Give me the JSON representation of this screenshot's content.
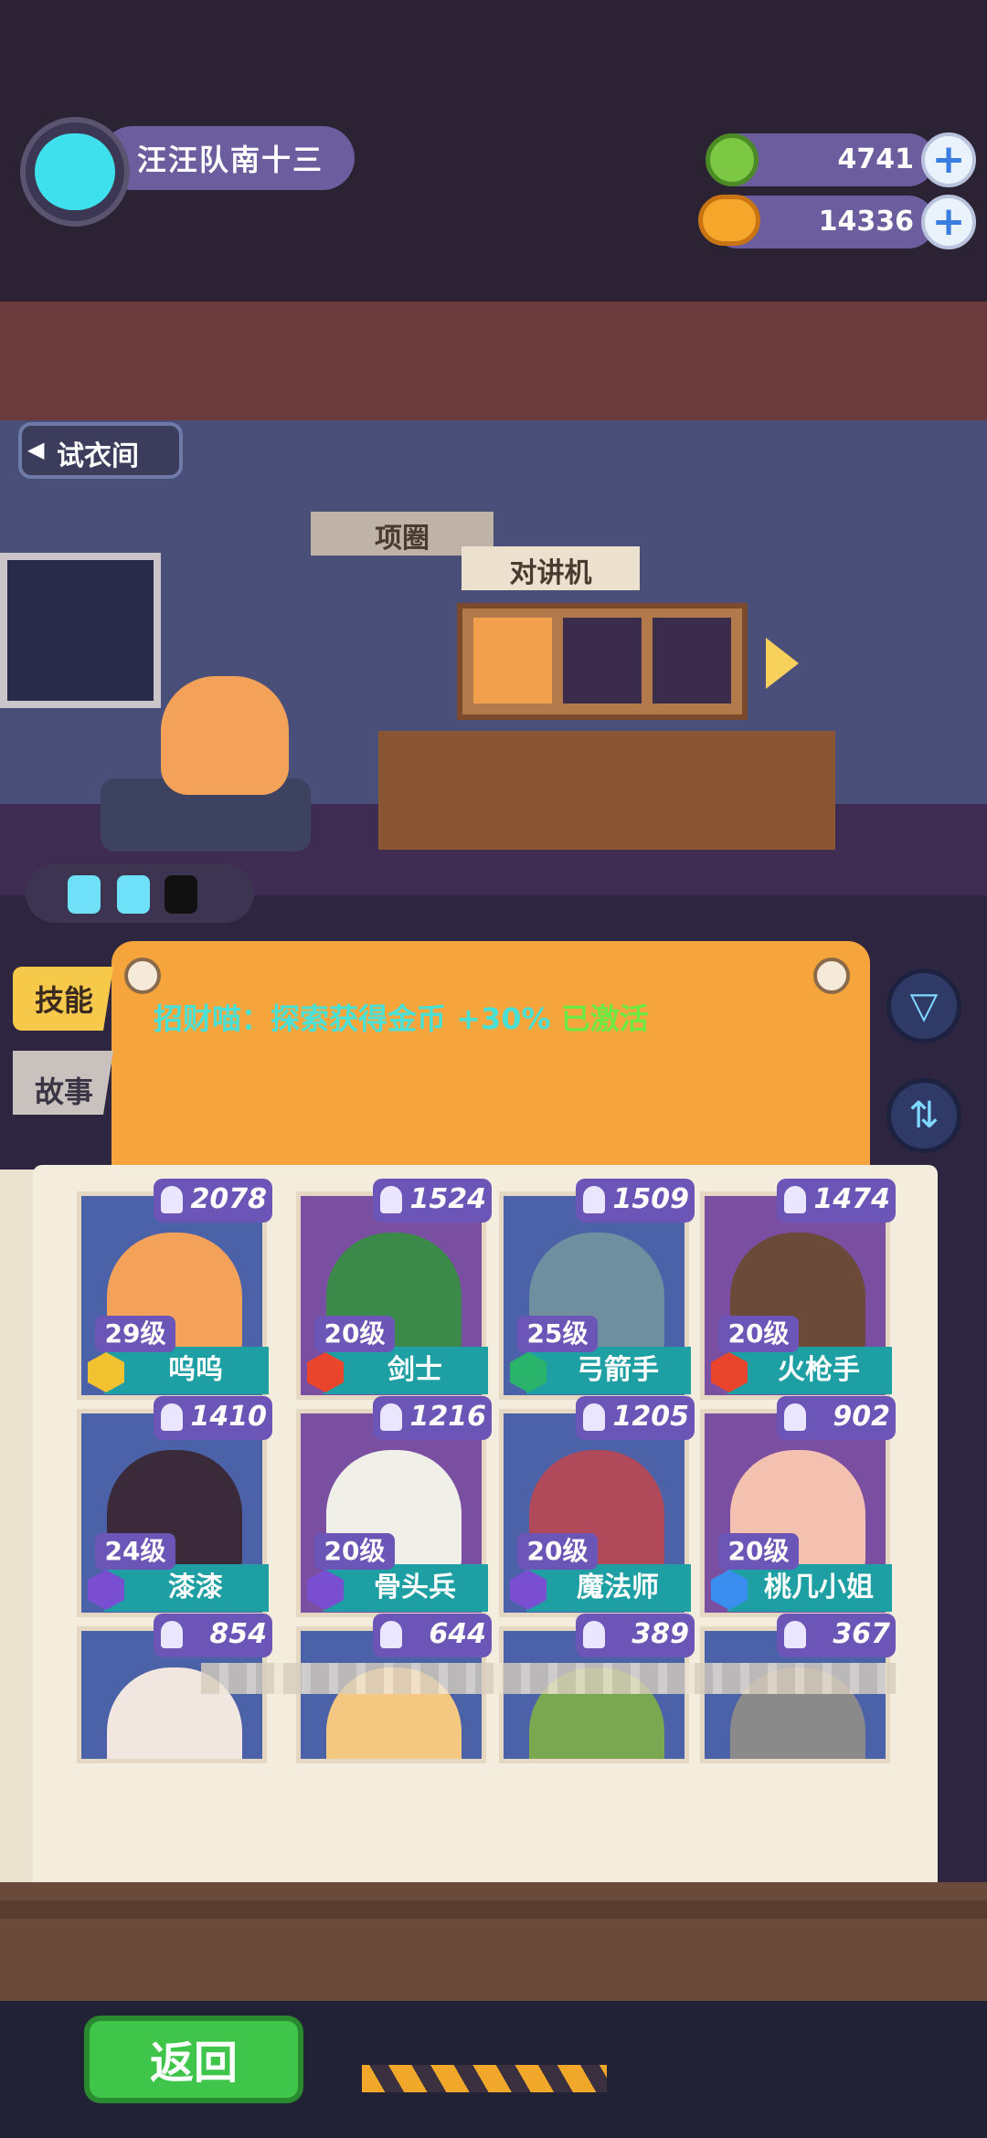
{
  "player": {
    "name": "汪汪队南十三"
  },
  "currency": [
    {
      "name": "green-gem",
      "value": "4741"
    },
    {
      "name": "gold-coin",
      "value": "14336"
    }
  ],
  "room": {
    "trial_label": "试衣间"
  },
  "shelf": {
    "collar_label": "项圈",
    "radio_label": "对讲机"
  },
  "tabs": {
    "skill": "技能",
    "story": "故事"
  },
  "skill_board": {
    "text": "招财喵：探索获得金币 +30%",
    "status": "已激活"
  },
  "characters": [
    {
      "power": "2078",
      "level": "29级",
      "name": "呜呜",
      "badge": "#f2c230"
    },
    {
      "power": "1524",
      "level": "20级",
      "name": "剑士",
      "badge": "#e8452c"
    },
    {
      "power": "1509",
      "level": "25级",
      "name": "弓箭手",
      "badge": "#2ab36a"
    },
    {
      "power": "1474",
      "level": "20级",
      "name": "火枪手",
      "badge": "#e8452c"
    },
    {
      "power": "1410",
      "level": "24级",
      "name": "漆漆",
      "badge": "#7a4ed0"
    },
    {
      "power": "1216",
      "level": "20级",
      "name": "骨头兵",
      "badge": "#7a4ed0"
    },
    {
      "power": "1205",
      "level": "20级",
      "name": "魔法师",
      "badge": "#7a4ed0"
    },
    {
      "power": "902",
      "level": "20级",
      "name": "桃几小姐",
      "badge": "#3a8ef0"
    },
    {
      "power": "854"
    },
    {
      "power": "644"
    },
    {
      "power": "389"
    },
    {
      "power": "367"
    }
  ],
  "footer": {
    "back_label": "返回"
  }
}
